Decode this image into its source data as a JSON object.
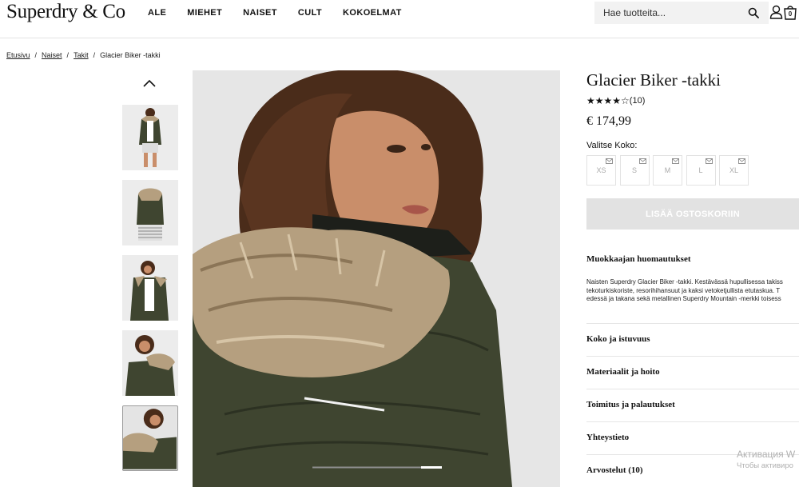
{
  "header": {
    "logo": "Superdry & Co",
    "nav": [
      "ALE",
      "MIEHET",
      "NAISET",
      "CULT",
      "KOKOELMAT"
    ],
    "search_placeholder": "Hae tuotteita...",
    "bag_count": "0"
  },
  "breadcrumb": [
    "Etusivu",
    "Naiset",
    "Takit",
    "Glacier Biker -takki"
  ],
  "product": {
    "title": "Glacier Biker -takki",
    "stars": "★★★★☆",
    "review_count": "(10)",
    "price": "€ 174,99",
    "size_label": "Valitse Koko:",
    "sizes": [
      "XS",
      "S",
      "M",
      "L",
      "XL"
    ],
    "add_to_cart": "LISÄÄ OSTOSKORIIN",
    "notes_heading": "Muokkaajan huomautukset",
    "description_lines": [
      "Naisten Superdry Glacier Biker -takki. Kestävässä hupullisessa takiss",
      "tekoturkiskoriste, resorihihansuut ja kaksi vetoketjullista etutaskua. T",
      "edessä ja takana sekä metallinen Superdry Mountain -merkki toisess"
    ],
    "sections": [
      "Koko ja istuvuus",
      "Materiaalit ja hoito",
      "Toimitus ja palautukset",
      "Yhteystieto",
      "Arvostelut (10)"
    ]
  },
  "colors": {
    "jacket": "#3f4530",
    "fur": "#b59f7f",
    "hair": "#4a2c1a",
    "skin": "#c98e6a"
  },
  "watermark": {
    "title": "Активация W",
    "subtitle": "Чтобы активиро"
  }
}
